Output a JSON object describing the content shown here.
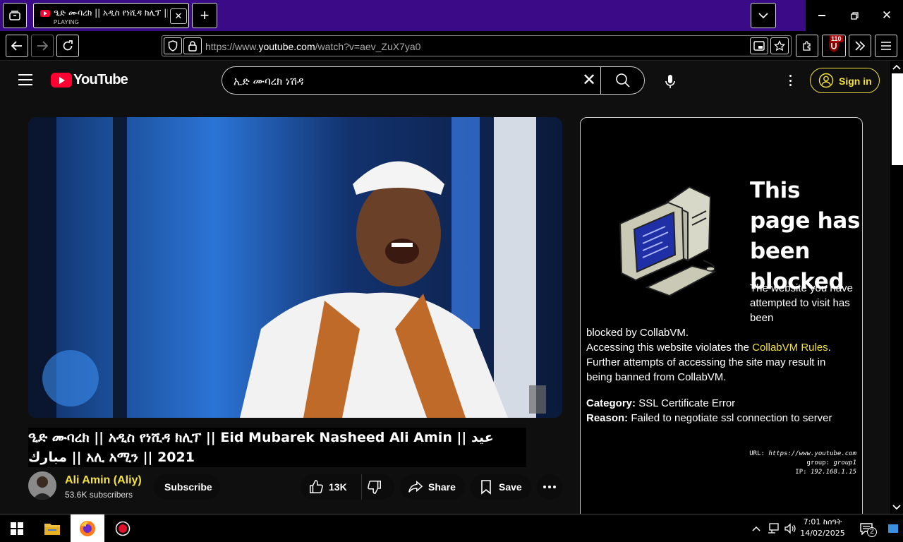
{
  "browser": {
    "tab": {
      "title": "ዒድ ሙባረክ || አዲስ የነሺዳ ክሊፕ || Eid Mubarek Nasheed Ali Amin",
      "status": "PLAYING"
    },
    "url": {
      "prefix": "https://www.",
      "domain": "youtube.com",
      "path": "/watch?v=aev_ZuX7ya0"
    },
    "extension_badge": "110"
  },
  "youtube": {
    "logo_text": "YouTube",
    "search_value": "ኢድ ሙባረክ ነሽዳ",
    "signin_label": "Sign in",
    "video": {
      "title": "ዒድ ሙባረክ || አዲስ የነሺዳ ክሊፕ || Eid Mubarek Nasheed Ali Amin || عيد مبارك || አሊ አሚን || 2021",
      "channel": "Ali Amin (Aliy)",
      "subscribers": "53.6K subscribers",
      "subscribe_label": "Subscribe",
      "likes": "13K",
      "share_label": "Share",
      "save_label": "Save"
    }
  },
  "blocked": {
    "title": "This page has been blocked",
    "p1": "The website you have attempted to visit has been",
    "p2_a": "blocked by CollabVM.",
    "p2_b": "Accessing this website violates the ",
    "p2_link": "CollabVM Rules",
    "p2_c": ".",
    "p2_d": "Further attempts of accessing the site may result in being banned from CollabVM.",
    "category_label": "Category:",
    "category_value": "SSL Certificate Error",
    "reason_label": "Reason:",
    "reason_value": "Failed to negotiate ssl connection to server",
    "url_label": "URL:",
    "url_value": "https://www.youtube.com",
    "group_label": "group:",
    "group_value": "group1",
    "ip_label": "IP:",
    "ip_value": "192.168.1.15"
  },
  "taskbar": {
    "time": "7:01 ከሰዓት",
    "date": "14/02/2025",
    "notification_count": "2"
  },
  "colors": {
    "accent_yellow": "#f4e23d",
    "tabstrip_purple": "#3b0a86",
    "youtube_red": "#ff0033"
  }
}
